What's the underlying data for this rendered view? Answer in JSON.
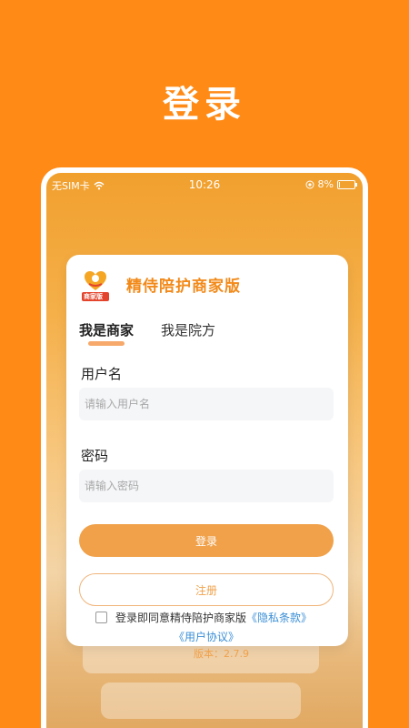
{
  "page": {
    "title": "登录"
  },
  "status_bar": {
    "carrier": "无SIM卡",
    "time": "10:26",
    "battery": "8%",
    "battery_level": 0.08
  },
  "app": {
    "name": "精侍陪护商家版",
    "logo_text": "商家版"
  },
  "tabs": [
    {
      "label": "我是商家",
      "active": true
    },
    {
      "label": "我是院方",
      "active": false
    }
  ],
  "form": {
    "username_label": "用户名",
    "username_placeholder": "请输入用户名",
    "password_label": "密码",
    "password_placeholder": "请输入密码",
    "login_button": "登录",
    "register_button": "注册"
  },
  "agreement": {
    "prefix": "登录即同意精侍陪护商家版",
    "privacy_link": "《隐私条款》",
    "user_link": "《用户协议》"
  },
  "version": "版本：2.7.9",
  "colors": {
    "background": "#FF8A16",
    "brand": "#F28A1A",
    "link": "#3B8FD6",
    "button": "#F0A14A"
  }
}
